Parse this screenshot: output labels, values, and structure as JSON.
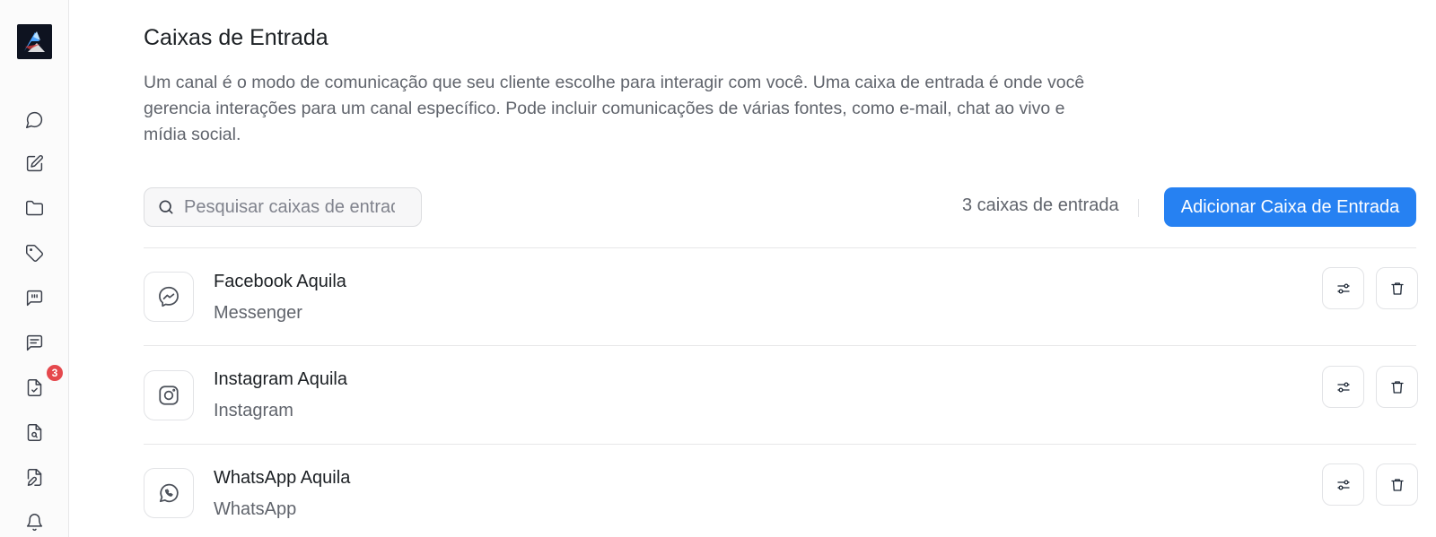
{
  "sidebar": {
    "logo": "logo",
    "items": [
      {
        "icon": "chat-bubble-icon"
      },
      {
        "icon": "compose-icon"
      },
      {
        "icon": "folder-icon"
      },
      {
        "icon": "tag-icon"
      },
      {
        "icon": "quote-message-icon"
      },
      {
        "icon": "message-lines-icon"
      },
      {
        "icon": "task-checklist-icon",
        "badge": "3"
      },
      {
        "icon": "document-search-icon"
      },
      {
        "icon": "document-edit-icon"
      },
      {
        "icon": "bell-icon"
      }
    ]
  },
  "page": {
    "title": "Caixas de Entrada",
    "description": "Um canal é o modo de comunicação que seu cliente escolhe para interagir com você. Uma caixa de entrada é onde você gerencia interações para um canal específico. Pode incluir comunicações de várias fontes, como e-mail, chat ao vivo e mídia social."
  },
  "toolbar": {
    "search_placeholder": "Pesquisar caixas de entrada",
    "count_label": "3 caixas de entrada",
    "add_button_label": "Adicionar Caixa de Entrada"
  },
  "inboxes": [
    {
      "name": "Facebook Aquila",
      "type": "Messenger",
      "icon": "messenger-icon"
    },
    {
      "name": "Instagram Aquila",
      "type": "Instagram",
      "icon": "instagram-icon"
    },
    {
      "name": "WhatsApp Aquila",
      "type": "WhatsApp",
      "icon": "whatsapp-icon"
    }
  ],
  "colors": {
    "accent": "#2681f2",
    "badge": "#e5484d",
    "text_primary": "#1c2024",
    "text_secondary": "#60646c"
  }
}
